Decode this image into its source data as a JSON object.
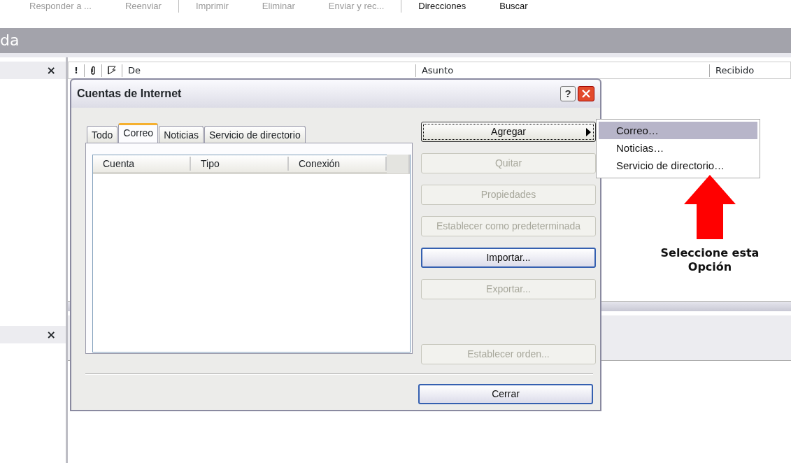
{
  "toolbar": [
    {
      "label": "Responder a ...",
      "disabled": true
    },
    {
      "label": "Reenviar",
      "disabled": true
    },
    {
      "label": "Imprimir",
      "disabled": true
    },
    {
      "label": "Eliminar",
      "disabled": true
    },
    {
      "label": "Enviar y rec...",
      "disabled": true
    },
    {
      "label": "Direcciones",
      "disabled": false
    },
    {
      "label": "Buscar",
      "disabled": false
    }
  ],
  "folder_title": "da",
  "panes": [
    {
      "close": "×"
    },
    {
      "close": "×"
    }
  ],
  "message_list": {
    "priority": "!",
    "columns": [
      "De",
      "Asunto",
      "Recibido"
    ]
  },
  "dialog": {
    "title": "Cuentas de Internet",
    "help": "?",
    "tabs": [
      {
        "label": "Todo",
        "selected": false
      },
      {
        "label": "Correo",
        "selected": true
      },
      {
        "label": "Noticias",
        "selected": false
      },
      {
        "label": "Servicio de directorio",
        "selected": false
      }
    ],
    "list_columns": [
      "Cuenta",
      "Tipo",
      "Conexión"
    ],
    "buttons": [
      {
        "label": "Agregar",
        "kind": "submenu",
        "disabled": false
      },
      {
        "label": "Quitar",
        "kind": "plain",
        "disabled": true
      },
      {
        "label": "Propiedades",
        "kind": "plain",
        "disabled": true
      },
      {
        "label": "Establecer como predeterminada",
        "kind": "plain",
        "disabled": true
      },
      {
        "label": "Importar...",
        "kind": "default",
        "disabled": false
      },
      {
        "label": "Exportar...",
        "kind": "plain",
        "disabled": true
      },
      {
        "label": "Establecer orden...",
        "kind": "spaced",
        "disabled": true
      }
    ],
    "close_button": "Cerrar"
  },
  "menu": [
    {
      "label": "Correo…",
      "selected": true
    },
    {
      "label": "Noticias…",
      "selected": false
    },
    {
      "label": "Servicio de directorio…",
      "selected": false
    }
  ],
  "annotation": "Seleccione esta Opción"
}
